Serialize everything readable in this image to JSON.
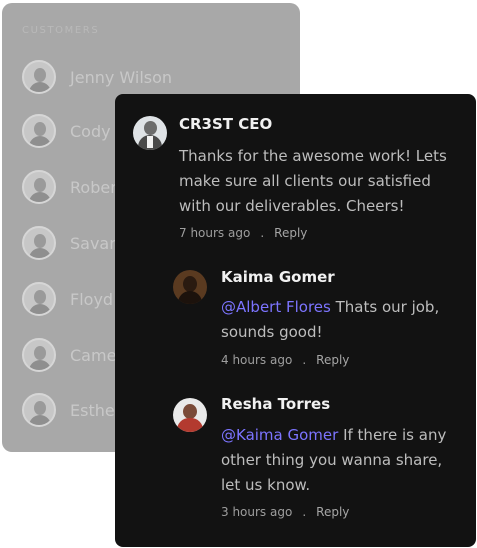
{
  "customers": {
    "heading": "CUSTOMERS",
    "items": [
      {
        "name": "Jenny Wilson"
      },
      {
        "name": "Cody"
      },
      {
        "name": "Rober"
      },
      {
        "name": "Savan"
      },
      {
        "name": "Floyd"
      },
      {
        "name": "Came"
      },
      {
        "name": "Esthe"
      }
    ]
  },
  "comments": [
    {
      "author": "CR3ST CEO",
      "mention": "",
      "text": "Thanks for the awesome work! Lets make sure all clients our satisfied with our deliverables. Cheers!",
      "time": "7 hours ago",
      "separator": ".",
      "reply_label": "Reply"
    },
    {
      "author": "Kaima Gomer",
      "mention": "@Albert Flores",
      "text": " Thats our job, sounds good!",
      "time": "4 hours ago",
      "separator": ".",
      "reply_label": "Reply"
    },
    {
      "author": "Resha Torres",
      "mention": "@Kaima Gomer",
      "text": " If there is any other thing you wanna share, let us know.",
      "time": "3 hours ago",
      "separator": ".",
      "reply_label": "Reply"
    }
  ],
  "colors": {
    "card_bg": "#121212",
    "mention": "#7c74ff",
    "panel_bg": "#a8a8a8"
  }
}
